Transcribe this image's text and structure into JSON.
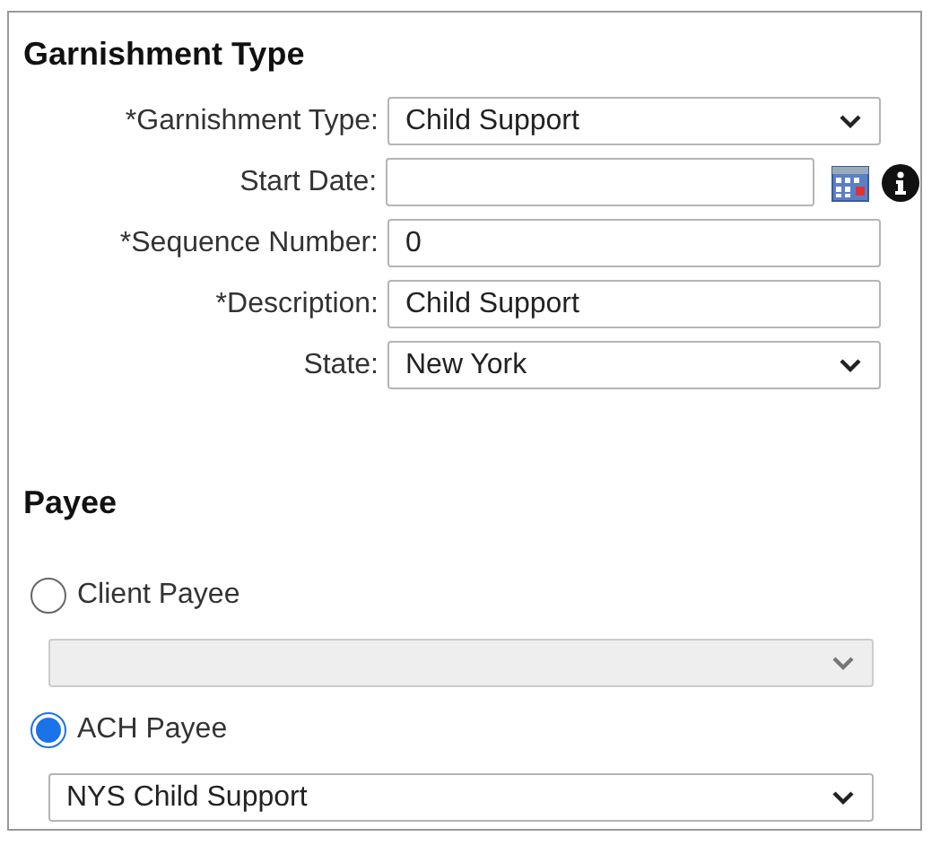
{
  "sections": [
    {
      "title": "Garnishment Type",
      "fields": [
        {
          "kind": "select",
          "label": "*Garnishment Type:",
          "value": "Child Support"
        },
        {
          "kind": "date",
          "label": "Start Date:"
        },
        {
          "kind": "text",
          "label": "*Sequence Number:",
          "value": "0"
        },
        {
          "kind": "text",
          "label": "*Description:",
          "value": "Child Support"
        },
        {
          "kind": "select",
          "label": "State:",
          "value": "New York"
        }
      ]
    },
    {
      "title": "Payee",
      "options": [
        {
          "label": "Client Payee",
          "selected": false,
          "select": {
            "disabled": true
          }
        },
        {
          "label": "ACH Payee",
          "selected": true,
          "select": {
            "disabled": false,
            "value": "NYS Child Support"
          }
        }
      ]
    }
  ]
}
